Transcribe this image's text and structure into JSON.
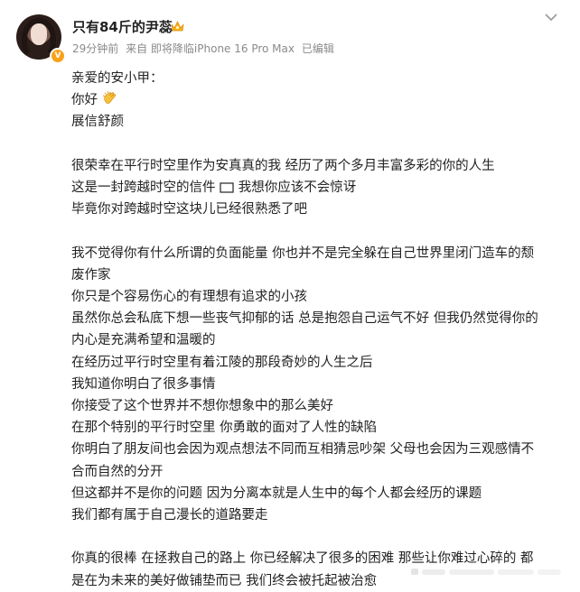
{
  "user": {
    "name": "只有84斤的尹蕊"
  },
  "meta": {
    "time": "29分钟前",
    "source": "来自 即将降临iPhone 16 Pro Max",
    "edited": "已编辑"
  },
  "content": {
    "lines": [
      "亲爱的安小甲：",
      "你好",
      "展信舒颜",
      "",
      "很荣幸在平行时空里作为安真真的我 经历了两个多月丰富多彩的你的人生",
      "这是一封跨越时空的信件",
      "我想你应该不会惊讶",
      "毕竟你对跨越时空这块儿已经很熟悉了吧",
      "",
      "我不觉得你有什么所谓的负面能量 你也并不是完全躲在自己世界里闭门造车的颓",
      "废作家",
      "你只是个容易伤心的有理想有追求的小孩",
      "虽然你总会私底下想一些丧气抑郁的话 总是抱怨自己运气不好 但我仍然觉得你的",
      "内心是充满希望和温暖的",
      "在经历过平行时空里有着江陵的那段奇妙的人生之后",
      "我知道你明白了很多事情",
      "你接受了这个世界并不想你想象中的那么美好",
      "在那个特别的平行时空里 你勇敢的面对了人性的缺陷",
      "你明白了朋友间也会因为观点想法不同而互相猜忌吵架 父母也会因为三观感情不",
      "合而自然的分开",
      "但这都并不是你的问题 因为分离本就是人生中的每个人都会经历的课题",
      "我们都有属于自己漫长的道路要走",
      "",
      "你真的很棒 在拯救自己的路上 你已经解决了很多的困难 那些让你难过心碎的 都",
      "是在为未来的美好做铺垫而已 我们终会被托起被治愈"
    ]
  }
}
